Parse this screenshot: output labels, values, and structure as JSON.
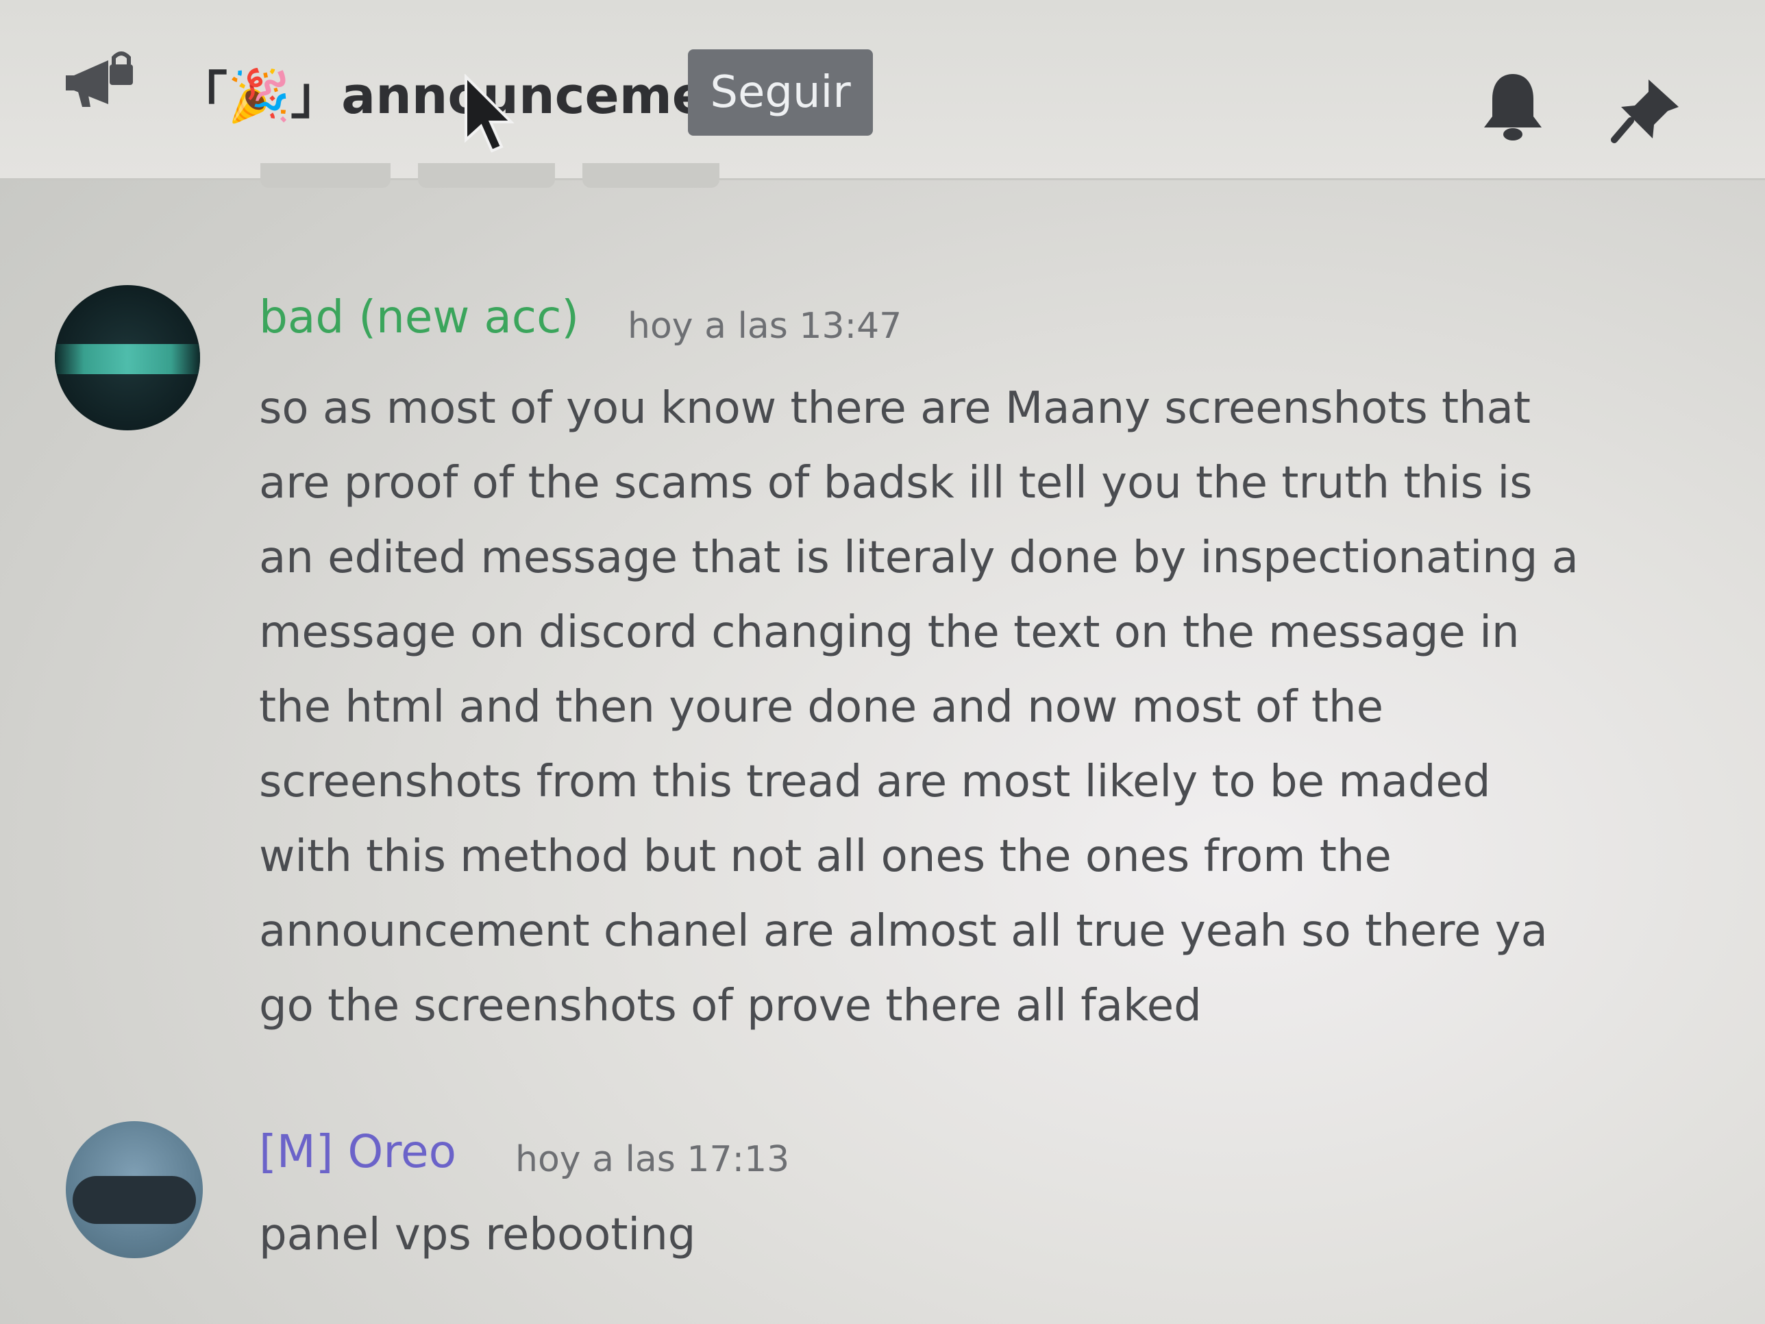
{
  "header": {
    "channel_name": "「🎉」announcements",
    "follow_label": "Seguir",
    "channel_icon": "megaphone-lock-icon",
    "bell_icon": "bell-icon",
    "pin_icon": "pin-icon"
  },
  "messages": [
    {
      "author": "bad (new acc)",
      "author_color": "#3ba55c",
      "timestamp": "hoy a las 13:47",
      "lines": [
        "so as most of you know there are Maany screenshots that",
        "are proof of the scams of badsk ill tell you the truth this is",
        "an edited message that is literaly done by  inspectionating a",
        "message on discord changing the text on the message in",
        "the html and then youre done and now most of the",
        "screenshots from this tread are most likely to be maded",
        "with this method but not all ones the ones from the",
        "announcement chanel are almost all true yeah so there ya",
        "go the screenshots of prove there all faked"
      ]
    },
    {
      "author": "[M] Oreo",
      "author_color": "#6b63c9",
      "timestamp": "hoy a las 17:13",
      "lines": [
        "panel vps rebooting"
      ]
    }
  ],
  "colors": {
    "header_bg": "#dcdcd8",
    "follow_button_bg": "#6e7176",
    "text": "#4a4c50"
  }
}
